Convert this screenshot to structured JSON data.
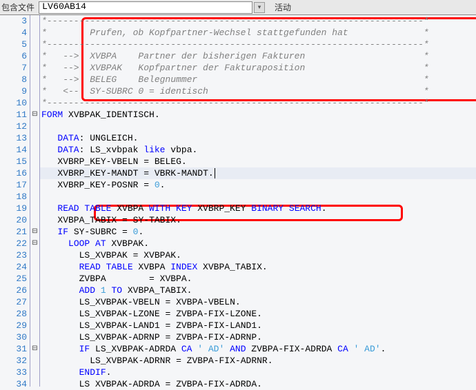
{
  "toolbar": {
    "label": "包含文件",
    "value": "LV60AB14",
    "status": "活动"
  },
  "gutter_start": 3,
  "gutter_end": 34,
  "fold_marks": {
    "11": "⊟",
    "21": "⊟",
    "22": "⊟",
    "31": "⊟"
  },
  "lines": {
    "3": [
      {
        "c": "comment",
        "t": "*----------------------------------------------------------------------*"
      }
    ],
    "4": [
      {
        "c": "comment",
        "t": "*        Prufen, ob Kopfpartner-Wechsel stattgefunden hat              *"
      }
    ],
    "5": [
      {
        "c": "comment",
        "t": "*----------------------------------------------------------------------*"
      }
    ],
    "6": [
      {
        "c": "comment",
        "t": "*   -->  XVBPA    Partner der bisherigen Fakturen                      *"
      }
    ],
    "7": [
      {
        "c": "comment",
        "t": "*   -->  XVBPAK   Kopfpartner der Fakturaposition                      *"
      }
    ],
    "8": [
      {
        "c": "comment",
        "t": "*   -->  BELEG    Belegnummer                                          *"
      }
    ],
    "9": [
      {
        "c": "comment",
        "t": "*   <--  SY-SUBRC 0 = identisch                                        *"
      }
    ],
    "10": [
      {
        "c": "comment",
        "t": "*----------------------------------------------------------------------*"
      }
    ],
    "11": [
      {
        "c": "keyword",
        "t": "FORM"
      },
      {
        "c": "ident",
        "t": " XVBPAK_IDENTISCH"
      },
      {
        "c": "op",
        "t": "."
      }
    ],
    "12": [],
    "13": [
      {
        "c": "ident",
        "t": "   "
      },
      {
        "c": "keyword",
        "t": "DATA"
      },
      {
        "c": "op",
        "t": ":"
      },
      {
        "c": "ident",
        "t": " UNGLEICH"
      },
      {
        "c": "op",
        "t": "."
      }
    ],
    "14": [
      {
        "c": "ident",
        "t": "   "
      },
      {
        "c": "keyword",
        "t": "DATA"
      },
      {
        "c": "op",
        "t": ":"
      },
      {
        "c": "ident",
        "t": " LS_xvbpak "
      },
      {
        "c": "keyword",
        "t": "like"
      },
      {
        "c": "ident",
        "t": " vbpa"
      },
      {
        "c": "op",
        "t": "."
      }
    ],
    "15": [
      {
        "c": "ident",
        "t": "   XVBRP_KEY"
      },
      {
        "c": "op",
        "t": "-"
      },
      {
        "c": "ident",
        "t": "VBELN "
      },
      {
        "c": "op",
        "t": "="
      },
      {
        "c": "ident",
        "t": " BELEG"
      },
      {
        "c": "op",
        "t": "."
      }
    ],
    "16": [
      {
        "c": "ident",
        "t": "   XVBRP_KEY"
      },
      {
        "c": "op",
        "t": "-"
      },
      {
        "c": "ident",
        "t": "MANDT "
      },
      {
        "c": "op",
        "t": "="
      },
      {
        "c": "ident",
        "t": " VBRK"
      },
      {
        "c": "op",
        "t": "-"
      },
      {
        "c": "ident",
        "t": "MANDT"
      },
      {
        "c": "op",
        "t": "."
      }
    ],
    "17": [
      {
        "c": "ident",
        "t": "   XVBRP_KEY"
      },
      {
        "c": "op",
        "t": "-"
      },
      {
        "c": "ident",
        "t": "POSNR "
      },
      {
        "c": "op",
        "t": "="
      },
      {
        "c": "num",
        "t": " 0"
      },
      {
        "c": "op",
        "t": "."
      }
    ],
    "18": [],
    "19": [
      {
        "c": "ident",
        "t": "   "
      },
      {
        "c": "keyword",
        "t": "READ TABLE"
      },
      {
        "c": "ident",
        "t": " XVBPA "
      },
      {
        "c": "keyword",
        "t": "WITH KEY"
      },
      {
        "c": "ident",
        "t": " XVBRP_KEY "
      },
      {
        "c": "keyword",
        "t": "BINARY SEARCH"
      },
      {
        "c": "op",
        "t": "."
      }
    ],
    "20": [
      {
        "c": "ident",
        "t": "   XVBPA_TABIX "
      },
      {
        "c": "op",
        "t": "="
      },
      {
        "c": "ident",
        "t": " SY"
      },
      {
        "c": "op",
        "t": "-"
      },
      {
        "c": "ident",
        "t": "TABIX"
      },
      {
        "c": "op",
        "t": "."
      }
    ],
    "21": [
      {
        "c": "ident",
        "t": "   "
      },
      {
        "c": "keyword",
        "t": "IF"
      },
      {
        "c": "ident",
        "t": " SY"
      },
      {
        "c": "op",
        "t": "-"
      },
      {
        "c": "ident",
        "t": "SUBRC "
      },
      {
        "c": "op",
        "t": "="
      },
      {
        "c": "num",
        "t": " 0"
      },
      {
        "c": "op",
        "t": "."
      }
    ],
    "22": [
      {
        "c": "ident",
        "t": "     "
      },
      {
        "c": "keyword",
        "t": "LOOP AT"
      },
      {
        "c": "ident",
        "t": " XVBPAK"
      },
      {
        "c": "op",
        "t": "."
      }
    ],
    "23": [
      {
        "c": "ident",
        "t": "       LS_XVBPAK "
      },
      {
        "c": "op",
        "t": "="
      },
      {
        "c": "ident",
        "t": " XVBPAK"
      },
      {
        "c": "op",
        "t": "."
      }
    ],
    "24": [
      {
        "c": "ident",
        "t": "       "
      },
      {
        "c": "keyword",
        "t": "READ TABLE"
      },
      {
        "c": "ident",
        "t": " XVBPA "
      },
      {
        "c": "keyword",
        "t": "INDEX"
      },
      {
        "c": "ident",
        "t": " XVBPA_TABIX"
      },
      {
        "c": "op",
        "t": "."
      }
    ],
    "25": [
      {
        "c": "ident",
        "t": "       ZVBPA        "
      },
      {
        "c": "op",
        "t": "="
      },
      {
        "c": "ident",
        "t": " XVBPA"
      },
      {
        "c": "op",
        "t": "."
      }
    ],
    "26": [
      {
        "c": "ident",
        "t": "       "
      },
      {
        "c": "keyword",
        "t": "ADD"
      },
      {
        "c": "num",
        "t": " 1"
      },
      {
        "c": "ident",
        "t": " "
      },
      {
        "c": "keyword",
        "t": "TO"
      },
      {
        "c": "ident",
        "t": " XVBPA_TABIX"
      },
      {
        "c": "op",
        "t": "."
      }
    ],
    "27": [
      {
        "c": "ident",
        "t": "       LS_XVBPAK"
      },
      {
        "c": "op",
        "t": "-"
      },
      {
        "c": "ident",
        "t": "VBELN "
      },
      {
        "c": "op",
        "t": "="
      },
      {
        "c": "ident",
        "t": " XVBPA"
      },
      {
        "c": "op",
        "t": "-"
      },
      {
        "c": "ident",
        "t": "VBELN"
      },
      {
        "c": "op",
        "t": "."
      }
    ],
    "28": [
      {
        "c": "ident",
        "t": "       LS_XVBPAK"
      },
      {
        "c": "op",
        "t": "-"
      },
      {
        "c": "ident",
        "t": "LZONE "
      },
      {
        "c": "op",
        "t": "="
      },
      {
        "c": "ident",
        "t": " ZVBPA"
      },
      {
        "c": "op",
        "t": "-"
      },
      {
        "c": "ident",
        "t": "FIX"
      },
      {
        "c": "op",
        "t": "-"
      },
      {
        "c": "ident",
        "t": "LZONE"
      },
      {
        "c": "op",
        "t": "."
      }
    ],
    "29": [
      {
        "c": "ident",
        "t": "       LS_XVBPAK"
      },
      {
        "c": "op",
        "t": "-"
      },
      {
        "c": "ident",
        "t": "LAND1 "
      },
      {
        "c": "op",
        "t": "="
      },
      {
        "c": "ident",
        "t": " ZVBPA"
      },
      {
        "c": "op",
        "t": "-"
      },
      {
        "c": "ident",
        "t": "FIX"
      },
      {
        "c": "op",
        "t": "-"
      },
      {
        "c": "ident",
        "t": "LAND1"
      },
      {
        "c": "op",
        "t": "."
      }
    ],
    "30": [
      {
        "c": "ident",
        "t": "       LS_XVBPAK"
      },
      {
        "c": "op",
        "t": "-"
      },
      {
        "c": "ident",
        "t": "ADRNP "
      },
      {
        "c": "op",
        "t": "="
      },
      {
        "c": "ident",
        "t": " ZVBPA"
      },
      {
        "c": "op",
        "t": "-"
      },
      {
        "c": "ident",
        "t": "FIX"
      },
      {
        "c": "op",
        "t": "-"
      },
      {
        "c": "ident",
        "t": "ADRNP"
      },
      {
        "c": "op",
        "t": "."
      }
    ],
    "31": [
      {
        "c": "ident",
        "t": "       "
      },
      {
        "c": "keyword",
        "t": "IF"
      },
      {
        "c": "ident",
        "t": " LS_XVBPAK"
      },
      {
        "c": "op",
        "t": "-"
      },
      {
        "c": "ident",
        "t": "ADRDA "
      },
      {
        "c": "keyword",
        "t": "CA"
      },
      {
        "c": "str",
        "t": " ' AD'"
      },
      {
        "c": "ident",
        "t": " "
      },
      {
        "c": "keyword",
        "t": "AND"
      },
      {
        "c": "ident",
        "t": " ZVBPA"
      },
      {
        "c": "op",
        "t": "-"
      },
      {
        "c": "ident",
        "t": "FIX"
      },
      {
        "c": "op",
        "t": "-"
      },
      {
        "c": "ident",
        "t": "ADRDA "
      },
      {
        "c": "keyword",
        "t": "CA"
      },
      {
        "c": "str",
        "t": " ' AD'"
      },
      {
        "c": "op",
        "t": "."
      }
    ],
    "32": [
      {
        "c": "ident",
        "t": "         LS_XVBPAK"
      },
      {
        "c": "op",
        "t": "-"
      },
      {
        "c": "ident",
        "t": "ADRNR "
      },
      {
        "c": "op",
        "t": "="
      },
      {
        "c": "ident",
        "t": " ZVBPA"
      },
      {
        "c": "op",
        "t": "-"
      },
      {
        "c": "ident",
        "t": "FIX"
      },
      {
        "c": "op",
        "t": "-"
      },
      {
        "c": "ident",
        "t": "ADRNR"
      },
      {
        "c": "op",
        "t": "."
      }
    ],
    "33": [
      {
        "c": "ident",
        "t": "       "
      },
      {
        "c": "keyword",
        "t": "ENDIF"
      },
      {
        "c": "op",
        "t": "."
      }
    ],
    "34": [
      {
        "c": "ident",
        "t": "       LS XVBPAK"
      },
      {
        "c": "op",
        "t": "-"
      },
      {
        "c": "ident",
        "t": "ADRDA "
      },
      {
        "c": "op",
        "t": "="
      },
      {
        "c": "ident",
        "t": " ZVBPA"
      },
      {
        "c": "op",
        "t": "-"
      },
      {
        "c": "ident",
        "t": "FIX"
      },
      {
        "c": "op",
        "t": "-"
      },
      {
        "c": "ident",
        "t": "ADRDA"
      },
      {
        "c": "op",
        "t": "."
      }
    ]
  },
  "highlighted_line": 16,
  "cursor_line": 16
}
